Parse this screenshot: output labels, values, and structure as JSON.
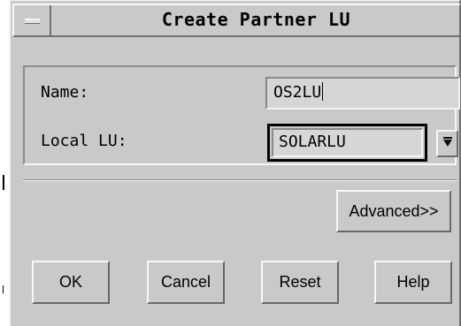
{
  "window": {
    "title": "Create Partner LU",
    "menu_icon": "window-menu-icon"
  },
  "form": {
    "name_label": "Name:",
    "name_value": "OS2LU",
    "local_lu_label": "Local LU:",
    "local_lu_value": "SOLARLU",
    "dropdown_icon": "dropdown-arrow-icon"
  },
  "buttons": {
    "advanced": "Advanced>>",
    "ok": "OK",
    "cancel": "Cancel",
    "reset": "Reset",
    "help": "Help"
  },
  "colors": {
    "window_background": "#c9c9c9",
    "field_background": "#d6d6d6",
    "text": "#000000"
  }
}
